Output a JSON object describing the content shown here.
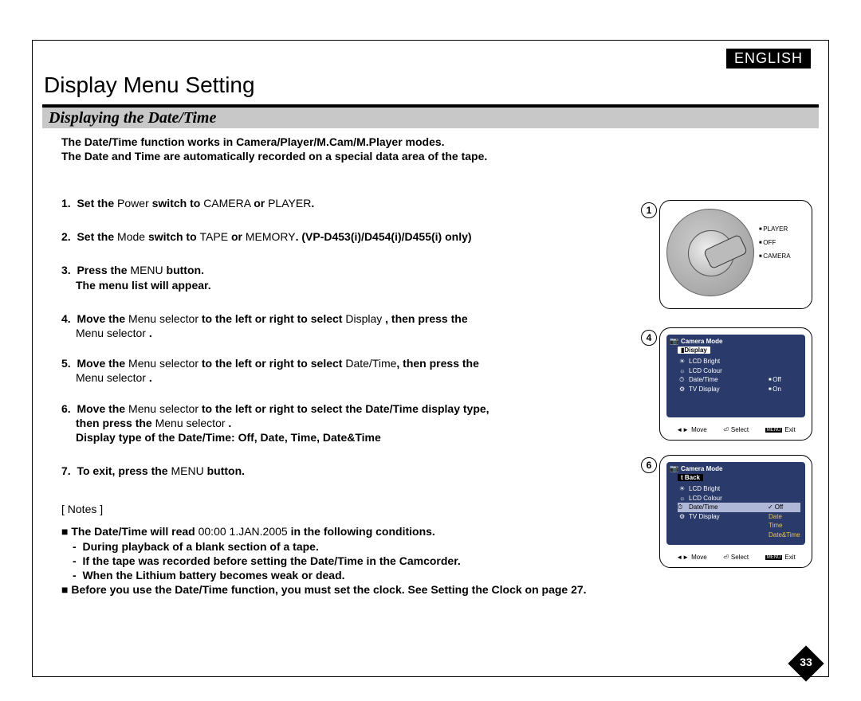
{
  "language_badge": "ENGLISH",
  "page_title": "Display Menu Setting",
  "section_title": "Displaying the Date/Time",
  "intro_line1": "The Date/Time function works in Camera/Player/M.Cam/M.Player modes.",
  "intro_line2": "The Date and Time are automatically recorded on a special data area of the tape.",
  "steps": {
    "s1_a": "Set the ",
    "s1_b": "Power ",
    "s1_c": "switch to ",
    "s1_d": "CAMERA ",
    "s1_e": "or ",
    "s1_f": "PLAYER",
    "s1_g": ".",
    "s2_a": "Set the ",
    "s2_b": "Mode ",
    "s2_c": "switch to ",
    "s2_d": "TAPE ",
    "s2_e": "or ",
    "s2_f": "MEMORY",
    "s2_g": ". (VP-D453(i)/D454(i)/D455(i) only)",
    "s3_a": "Press the ",
    "s3_b": "MENU ",
    "s3_c": "button.",
    "s3_d": "The menu list will appear.",
    "s4_a": "Move the ",
    "s4_b": "Menu selector ",
    "s4_c": " to the left or right to select ",
    "s4_d": "Display ",
    "s4_e": ", then press the",
    "s4_f": "Menu selector ",
    "s4_g": ".",
    "s5_a": "Move the ",
    "s5_b": "Menu selector ",
    "s5_c": " to the left or right to select ",
    "s5_d": "Date/Time",
    "s5_e": ", then press the",
    "s5_f": "Menu selector ",
    "s5_g": ".",
    "s6_a": "Move the ",
    "s6_b": "Menu selector ",
    "s6_c": " to the left or right to select the Date/Time display type,",
    "s6_d": "then press the ",
    "s6_e": "Menu selector ",
    "s6_f": ".",
    "s6_g": "Display type of the Date/Time: Off, Date, Time, Date&Time",
    "s7_a": "To exit, press the ",
    "s7_b": "MENU ",
    "s7_c": "button."
  },
  "notes_label": "[ Notes ]",
  "notes": {
    "n1_a": "The Date/Time will read ",
    "n1_b": "00:00 1.JAN.2005 ",
    "n1_c": " in the following conditions.",
    "n2": "During playback of a blank section of a tape.",
    "n3": "If the tape was recorded before setting the Date/Time in the Camcorder.",
    "n4": "When the Lithium battery becomes weak or dead.",
    "n5": "Before you use the Date/Time function, you must set the clock. See Setting the Clock on page 27."
  },
  "power_switch": {
    "p1": "PLAYER",
    "p2": "OFF",
    "p3": "CAMERA"
  },
  "fig4": {
    "title": "Camera Mode",
    "tab": "Display",
    "items": [
      "LCD Bright",
      "LCD Colour",
      "Date/Time",
      "TV Display"
    ],
    "icons": [
      "☀",
      "☼",
      "⏱",
      "⚙"
    ],
    "col2": [
      "",
      "",
      "Off",
      "On"
    ],
    "footer_move": "Move",
    "footer_select": "Select",
    "footer_exit": "Exit",
    "footer_menu": "MENU"
  },
  "fig6": {
    "title": "Camera Mode",
    "tab": "Back",
    "items": [
      "LCD Bright",
      "LCD Colour",
      "Date/Time",
      "TV Display"
    ],
    "icons": [
      "☀",
      "☼",
      "⏱",
      "⚙"
    ],
    "col2": [
      "Off",
      "Date",
      "Time",
      "Date&Time"
    ],
    "footer_move": "Move",
    "footer_select": "Select",
    "footer_exit": "Exit",
    "footer_menu": "MENU"
  },
  "fig_nums": {
    "f1": "1",
    "f4": "4",
    "f6": "6"
  },
  "page_number": "33"
}
